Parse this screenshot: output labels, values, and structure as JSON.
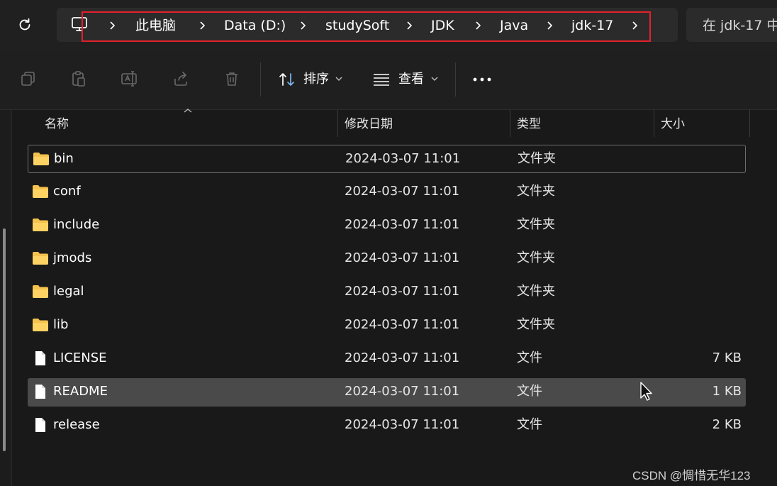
{
  "breadcrumbs": [
    "此电脑",
    "Data (D:)",
    "studySoft",
    "JDK",
    "Java",
    "jdk-17"
  ],
  "search": {
    "placeholder": "在 jdk-17 中"
  },
  "toolbar": {
    "sort_label": "排序",
    "view_label": "查看",
    "tools": [
      "copy-icon",
      "paste-icon",
      "rename-icon",
      "share-icon",
      "delete-icon"
    ]
  },
  "columns": {
    "name": "名称",
    "modified": "修改日期",
    "type": "类型",
    "size": "大小"
  },
  "files": [
    {
      "name": "bin",
      "modified": "2024-03-07 11:01",
      "type": "文件夹",
      "size": "",
      "kind": "folder"
    },
    {
      "name": "conf",
      "modified": "2024-03-07 11:01",
      "type": "文件夹",
      "size": "",
      "kind": "folder"
    },
    {
      "name": "include",
      "modified": "2024-03-07 11:01",
      "type": "文件夹",
      "size": "",
      "kind": "folder"
    },
    {
      "name": "jmods",
      "modified": "2024-03-07 11:01",
      "type": "文件夹",
      "size": "",
      "kind": "folder"
    },
    {
      "name": "legal",
      "modified": "2024-03-07 11:01",
      "type": "文件夹",
      "size": "",
      "kind": "folder"
    },
    {
      "name": "lib",
      "modified": "2024-03-07 11:01",
      "type": "文件夹",
      "size": "",
      "kind": "folder"
    },
    {
      "name": "LICENSE",
      "modified": "2024-03-07 11:01",
      "type": "文件",
      "size": "7 KB",
      "kind": "file"
    },
    {
      "name": "README",
      "modified": "2024-03-07 11:01",
      "type": "文件",
      "size": "1 KB",
      "kind": "file"
    },
    {
      "name": "release",
      "modified": "2024-03-07 11:01",
      "type": "文件",
      "size": "2 KB",
      "kind": "file"
    }
  ],
  "watermark": "CSDN @惆惜无华123",
  "colors": {
    "highlight": "#e2212b",
    "folder": "#f4c24d",
    "background": "#191919"
  }
}
